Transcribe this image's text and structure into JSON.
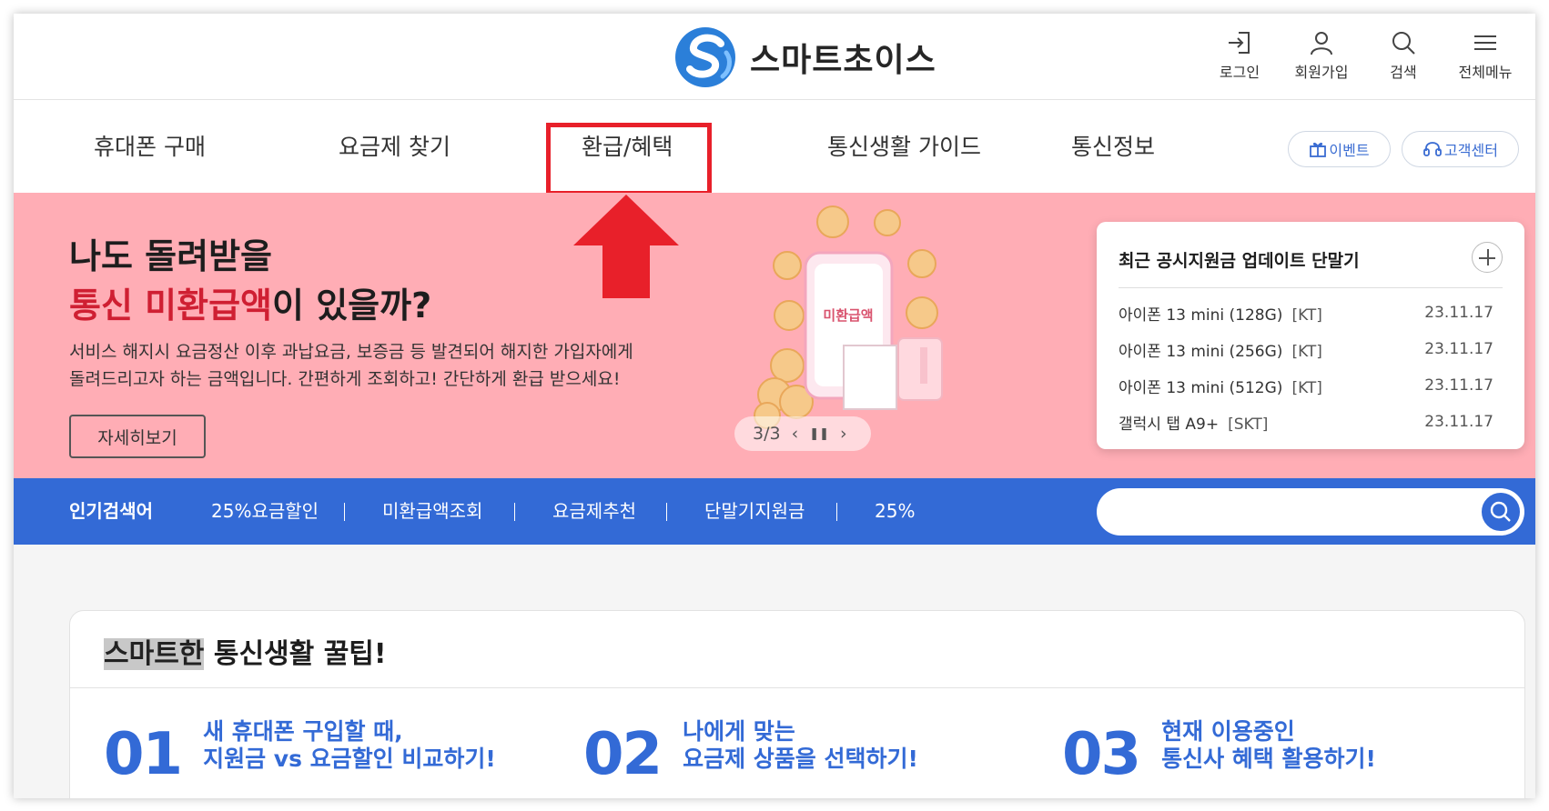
{
  "header": {
    "logo_text": "스마트초이스",
    "icons": [
      {
        "label": "로그인",
        "icon": "login-icon"
      },
      {
        "label": "회원가입",
        "icon": "user-icon"
      },
      {
        "label": "검색",
        "icon": "search-icon"
      },
      {
        "label": "전체메뉴",
        "icon": "menu-icon"
      }
    ]
  },
  "nav": {
    "items": [
      "휴대폰 구매",
      "요금제 찾기",
      "환급/혜택",
      "통신생활 가이드",
      "통신정보"
    ],
    "highlighted_item": "환급/혜택",
    "pills": [
      {
        "label": "이벤트",
        "icon": "gift-icon"
      },
      {
        "label": "고객센터",
        "icon": "headset-icon"
      }
    ]
  },
  "hero": {
    "title_line1": "나도 돌려받을",
    "title_line2_red": "통신 미환급액",
    "title_line2_rest": "이 있을까?",
    "desc_line1": "서비스 해지시 요금정산 이후 과납요금, 보증금 등 발견되어 해지한 가입자에게",
    "desc_line2": "돌려드리고자 하는 금액입니다. 간편하게 조회하고! 간단하게 환급 받으세요!",
    "button": "자세히보기",
    "illustration_label": "미환급액",
    "pager": "3/3"
  },
  "panel": {
    "title": "최근 공시지원금 업데이트 단말기",
    "items": [
      {
        "name": "아이폰 13 mini (128G)",
        "carrier": "[KT]",
        "date": "23.11.17"
      },
      {
        "name": "아이폰 13 mini (256G)",
        "carrier": "[KT]",
        "date": "23.11.17"
      },
      {
        "name": "아이폰 13 mini (512G)",
        "carrier": "[KT]",
        "date": "23.11.17"
      },
      {
        "name": "갤럭시 탭 A9+",
        "carrier": "[SKT]",
        "date": "23.11.17"
      }
    ]
  },
  "popular": {
    "label": "인기검색어",
    "keywords": [
      "25%요금할인",
      "미환급액조회",
      "요금제추천",
      "단말기지원금",
      "25%"
    ],
    "search_value": ""
  },
  "tips": {
    "title_highlight": "스마트한",
    "title_rest": " 통신생활 꿀팁!",
    "items": [
      {
        "num": "01",
        "line1": "새 휴대폰 구입할 때,",
        "line2": "지원금 vs 요금할인 비교하기!"
      },
      {
        "num": "02",
        "line1": "나에게 맞는",
        "line2": "요금제 상품을 선택하기!"
      },
      {
        "num": "03",
        "line1": "현재 이용중인",
        "line2": "통신사 혜택 활용하기!"
      }
    ]
  },
  "colors": {
    "accent_blue": "#336ad6",
    "hero_pink": "#ffadb5",
    "highlight_red": "#e8202a",
    "title_red": "#cf1f32"
  }
}
